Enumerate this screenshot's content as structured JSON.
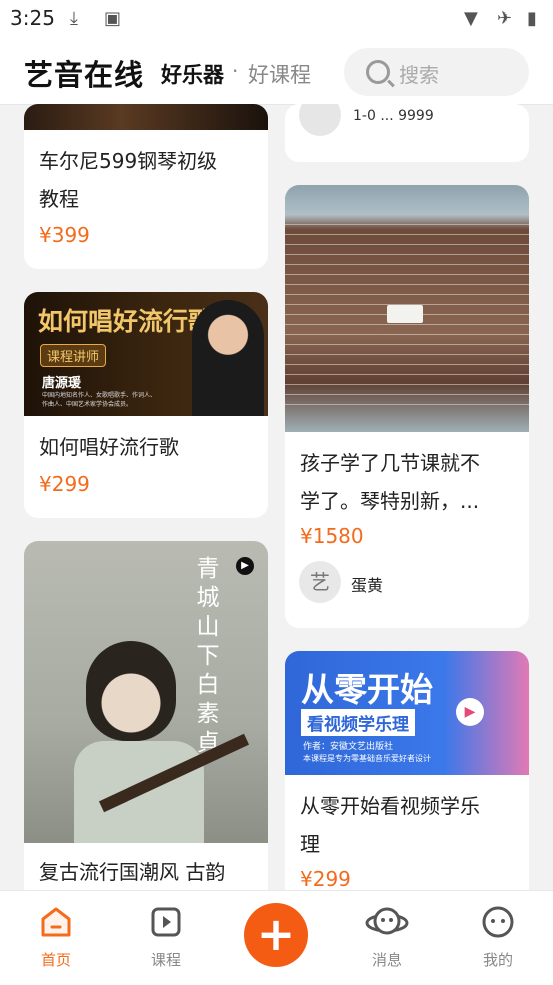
{
  "status": {
    "time": "3:25"
  },
  "header": {
    "brand": "艺音在线",
    "tab_active": "好乐器",
    "separator": "·",
    "tab_inactive": "好课程"
  },
  "search": {
    "placeholder": "搜索"
  },
  "cards": [
    {
      "title_line1": "车尔尼599钢琴初级",
      "title_line2": "教程",
      "price": "¥399"
    },
    {
      "title": "如何唱好流行歌",
      "price": "¥299",
      "banner_title": "如何唱好流行歌",
      "banner_badge": "课程讲师",
      "banner_name": "唐源瑗",
      "banner_desc_1": "中国内地知名作人、女歌唱歌手、作词人、",
      "banner_desc_2": "作曲人、中国艺术家学协会成员。"
    },
    {
      "title": "复古流行国潮风 古韵",
      "poster_text": "青城山下白素貞"
    },
    {
      "truncated_text": "1-0 ... 9999"
    },
    {
      "title_line1": "孩子学了几节课就不",
      "title_line2": "学了。琴特别新，...",
      "price": "¥1580",
      "author": "蛋黄",
      "avatar_text": "艺"
    },
    {
      "title_line1": "从零开始看视频学乐",
      "title_line2": "理",
      "price": "¥299",
      "banner_title": "从零开始",
      "banner_sub": "看视频学乐理",
      "banner_author": "作者：安徽文艺出版社",
      "banner_desc": "本课程是专为零基础音乐爱好者设计"
    }
  ],
  "nav": [
    {
      "label": "首页",
      "icon": "home-icon",
      "active": true
    },
    {
      "label": "课程",
      "icon": "course-icon"
    },
    {
      "label": "消息",
      "icon": "message-icon"
    },
    {
      "label": "我的",
      "icon": "profile-icon"
    }
  ],
  "colors": {
    "accent": "#f36b1c",
    "fab": "#f45c14"
  }
}
